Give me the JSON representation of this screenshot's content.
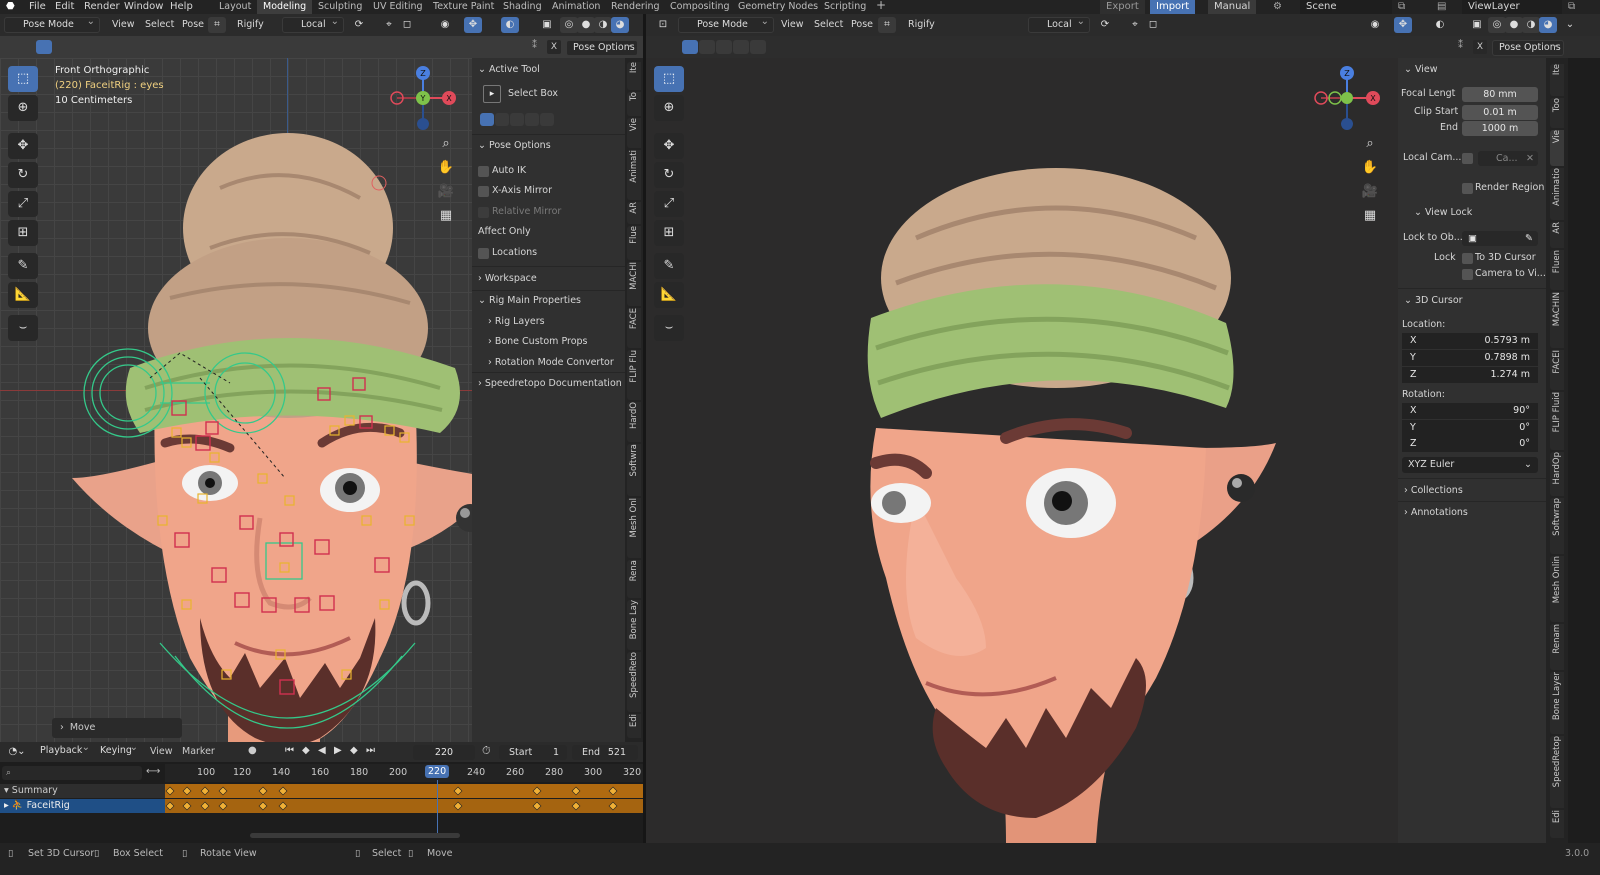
{
  "app": {
    "version": "3.0.0"
  },
  "menu": {
    "items": [
      "File",
      "Edit",
      "Render",
      "Window",
      "Help"
    ]
  },
  "workspaces": {
    "tabs": [
      "Layout",
      "Modeling",
      "Sculpting",
      "UV Editing",
      "Texture Paint",
      "Shading",
      "Animation",
      "Rendering",
      "Compositing",
      "Geometry Nodes",
      "Scripting"
    ],
    "active": "Modeling"
  },
  "topright": {
    "export": "Export",
    "import": "Import",
    "manual": "Manual",
    "scene": "Scene",
    "view_layer": "ViewLayer"
  },
  "left_viewport": {
    "mode": "Pose Mode",
    "menus": [
      "View",
      "Select",
      "Pose"
    ],
    "rigify": "Rigify",
    "orientation": "Local",
    "pose_options_btn": "Pose Options",
    "overlay_lines": [
      "Front Orthographic",
      "(220) FaceitRig : eyes",
      "10 Centimeters"
    ],
    "last_op": "Move",
    "npanel": {
      "active_tool_title": "Active Tool",
      "select_box": "Select Box",
      "pose_options_title": "Pose Options",
      "auto_ik": "Auto IK",
      "x_axis_mirror": "X-Axis Mirror",
      "relative_mirror": "Relative Mirror",
      "affect_only": "Affect Only",
      "locations": "Locations",
      "workspace": "Workspace",
      "rig_main": "Rig Main Properties",
      "rig_layers": "Rig Layers",
      "bone_custom": "Bone Custom Props",
      "rotation_conv": "Rotation Mode Convertor",
      "speedretopo": "Speedretopo Documentation"
    },
    "tabs": [
      "Ite",
      "To",
      "Vie",
      "Animati",
      "AR",
      "Flue",
      "MACHI",
      "FACE",
      "FLIP Flu",
      "HardO",
      "Softwra",
      "Mesh Onl",
      "Rena",
      "Bone Lay",
      "SpeedReto",
      "Edi"
    ]
  },
  "right_viewport": {
    "mode": "Pose Mode",
    "menus": [
      "View",
      "Select",
      "Pose"
    ],
    "rigify": "Rigify",
    "orientation": "Local",
    "pose_options_btn": "Pose Options",
    "npanel": {
      "view_title": "View",
      "focal_label": "Focal Lengt",
      "focal_value": "80 mm",
      "clip_start_label": "Clip Start",
      "clip_start_value": "0.01 m",
      "clip_end_label": "End",
      "clip_end_value": "1000 m",
      "local_cam_label": "Local Cam...",
      "local_cam_value": "Ca...",
      "render_region": "Render Region",
      "view_lock_title": "View Lock",
      "lock_to_obj": "Lock to Ob...",
      "lock_label": "Lock",
      "to_3d_cursor": "To 3D Cursor",
      "camera_to_view": "Camera to Vi...",
      "cursor_title": "3D Cursor",
      "location_label": "Location:",
      "loc": [
        {
          "axis": "X",
          "value": "0.5793 m"
        },
        {
          "axis": "Y",
          "value": "0.7898 m"
        },
        {
          "axis": "Z",
          "value": "1.274 m"
        }
      ],
      "rotation_label": "Rotation:",
      "rot": [
        {
          "axis": "X",
          "value": "90°"
        },
        {
          "axis": "Y",
          "value": "0°"
        },
        {
          "axis": "Z",
          "value": "0°"
        }
      ],
      "rot_mode": "XYZ Euler",
      "collections": "Collections",
      "annotations": "Annotations"
    },
    "tabs": [
      "Ite",
      "Too",
      "Vie",
      "Animatio",
      "AR",
      "Fluen",
      "MACHIN",
      "FACEI",
      "FLIP Fluid",
      "HardOp",
      "Softwrap",
      "Mesh Onlin",
      "Renam",
      "Bone Layer",
      "SpeedRetop",
      "Edi"
    ]
  },
  "timeline": {
    "menus": [
      "Playback",
      "Keying",
      "View",
      "Marker"
    ],
    "current_frame": "220",
    "start_label": "Start",
    "start_value": "1",
    "end_label": "End",
    "end_value": "521",
    "ruler": [
      "100",
      "120",
      "140",
      "160",
      "180",
      "200",
      "220",
      "240",
      "260",
      "280",
      "300",
      "320"
    ],
    "rows": [
      {
        "label": "Summary"
      },
      {
        "label": "FaceitRig"
      }
    ]
  },
  "statusbar": {
    "items": [
      "Set 3D Cursor",
      "Box Select",
      "Rotate View",
      "Select",
      "Move"
    ],
    "version": "3.0.0"
  },
  "colors": {
    "accent": "#4772b3",
    "bone_red": "#d0304f",
    "bone_yellow": "#e8b42e",
    "bone_green": "#34c98a",
    "keyframe": "#f0b035",
    "hair": "#c8a88a",
    "band": "#9fc074",
    "skin": "#f0a58a"
  }
}
